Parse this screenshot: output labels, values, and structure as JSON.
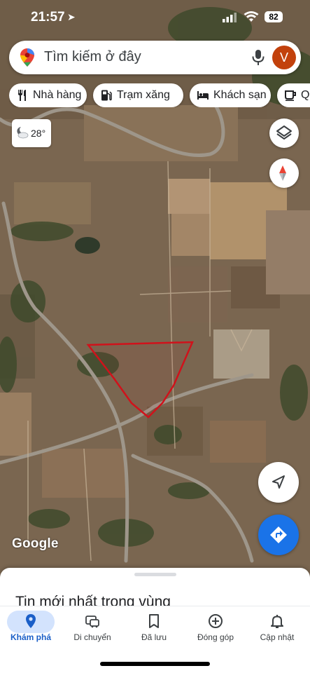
{
  "status_bar": {
    "time": "21:57",
    "battery": "82"
  },
  "search": {
    "placeholder": "Tìm kiếm ở đây",
    "avatar_letter": "V"
  },
  "chips": [
    {
      "label": "Nhà hàng",
      "icon": "restaurant-icon"
    },
    {
      "label": "Trạm xăng",
      "icon": "gas-station-icon"
    },
    {
      "label": "Khách sạn",
      "icon": "hotel-icon"
    },
    {
      "label": "Quá",
      "icon": "cafe-icon"
    }
  ],
  "weather": {
    "temp": "28°",
    "icon": "partly-cloudy-night-icon"
  },
  "map": {
    "attribution": "Google",
    "parcel_outline_color": "#d0121b"
  },
  "sheet": {
    "title": "Tin mới nhất trong vùng"
  },
  "tabs": [
    {
      "label": "Khám phá",
      "icon": "explore-pin-icon",
      "active": true
    },
    {
      "label": "Di chuyển",
      "icon": "commute-icon",
      "active": false
    },
    {
      "label": "Đã lưu",
      "icon": "bookmark-icon",
      "active": false
    },
    {
      "label": "Đóng góp",
      "icon": "add-circle-icon",
      "active": false
    },
    {
      "label": "Cập nhật",
      "icon": "bell-icon",
      "active": false
    }
  ],
  "colors": {
    "accent": "#1a73e8",
    "active_pill": "#d3e3fd",
    "avatar": "#c2410c"
  }
}
